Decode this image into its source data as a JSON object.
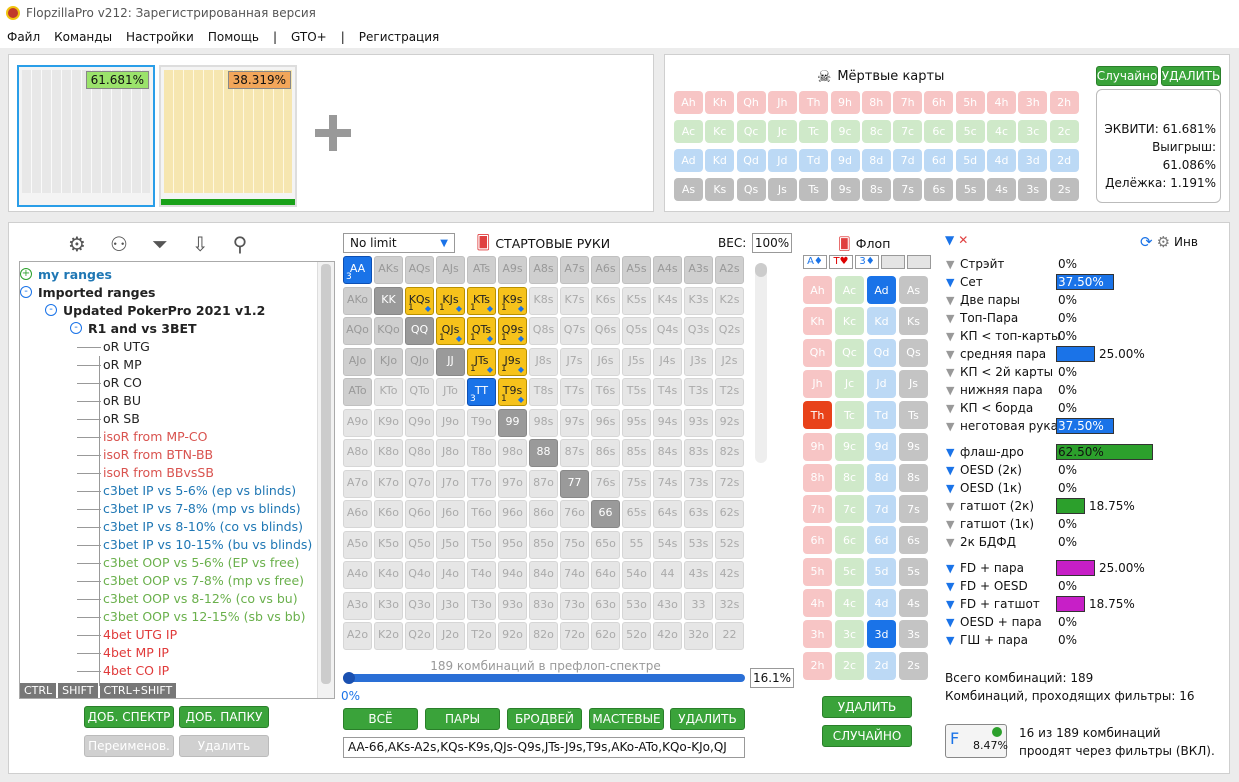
{
  "title": "FlopzillaPro v212: Зарегистрированная версия",
  "menu": [
    "Файл",
    "Команды",
    "Настройки",
    "Помощь",
    "|",
    "GTO+",
    "|",
    "Регистрация"
  ],
  "thumbs": [
    {
      "equity": "61.681%"
    },
    {
      "equity": "38.319%"
    }
  ],
  "dead_cards": {
    "label": "Мёртвые карты",
    "random_label": "Случайно",
    "delete_label": "УДАЛИТЬ",
    "rows": [
      [
        "Ah",
        "Kh",
        "Qh",
        "Jh",
        "Th",
        "9h",
        "8h",
        "7h",
        "6h",
        "5h",
        "4h",
        "3h",
        "2h"
      ],
      [
        "Ac",
        "Kc",
        "Qc",
        "Jc",
        "Tc",
        "9c",
        "8c",
        "7c",
        "6c",
        "5c",
        "4c",
        "3c",
        "2c"
      ],
      [
        "Ad",
        "Kd",
        "Qd",
        "Jd",
        "Td",
        "9d",
        "8d",
        "7d",
        "6d",
        "5d",
        "4d",
        "3d",
        "2d"
      ],
      [
        "As",
        "Ks",
        "Qs",
        "Js",
        "Ts",
        "9s",
        "8s",
        "7s",
        "6s",
        "5s",
        "4s",
        "3s",
        "2s"
      ]
    ],
    "equity": "ЭКВИТИ: 61.681%",
    "win": "Выигрыш: 61.086%",
    "tie": "Делёжка: 1.191%"
  },
  "tree": {
    "items": [
      {
        "label": "my ranges",
        "color": "#1f77b4",
        "bold": true,
        "indent": 0,
        "sign": "+"
      },
      {
        "label": "Imported ranges",
        "color": "#222",
        "bold": true,
        "indent": 0,
        "sign": "-"
      },
      {
        "label": "Updated PokerPro 2021 v1.2",
        "color": "#222",
        "bold": true,
        "indent": 1,
        "sign": "-"
      },
      {
        "label": "R1 and vs 3BET",
        "color": "#222",
        "bold": true,
        "indent": 2,
        "sign": "-"
      },
      {
        "label": "oR UTG",
        "color": "#222",
        "indent": 3
      },
      {
        "label": "oR MP",
        "color": "#222",
        "indent": 3
      },
      {
        "label": "oR CO",
        "color": "#222",
        "indent": 3
      },
      {
        "label": "oR BU",
        "color": "#222",
        "indent": 3
      },
      {
        "label": "oR SB",
        "color": "#222",
        "indent": 3
      },
      {
        "label": "isoR from MP-CO",
        "color": "#d9534f",
        "indent": 3
      },
      {
        "label": "isoR from BTN-BB",
        "color": "#d9534f",
        "indent": 3
      },
      {
        "label": "isoR from BBvsSB",
        "color": "#d9534f",
        "indent": 3
      },
      {
        "label": "c3bet IP vs 5-6% (ep vs blinds)",
        "color": "#1f77b4",
        "indent": 3
      },
      {
        "label": "c3bet IP vs 7-8% (mp vs blinds)",
        "color": "#1f77b4",
        "indent": 3
      },
      {
        "label": "c3bet IP vs 8-10% (co vs blinds)",
        "color": "#1f77b4",
        "indent": 3
      },
      {
        "label": "c3bet IP vs 10-15% (bu vs blinds)",
        "color": "#1f77b4",
        "indent": 3
      },
      {
        "label": "c3bet OOP vs 5-6% (EP vs free)",
        "color": "#6ab04c",
        "indent": 3
      },
      {
        "label": "c3bet OOP vs 7-8% (mp vs free)",
        "color": "#6ab04c",
        "indent": 3
      },
      {
        "label": "c3bet OOP vs 8-12% (co vs bu)",
        "color": "#6ab04c",
        "indent": 3
      },
      {
        "label": "c3bet OOP vs 12-15% (sb vs bb)",
        "color": "#6ab04c",
        "indent": 3
      },
      {
        "label": "4bet UTG IP",
        "color": "#e03a3a",
        "indent": 3
      },
      {
        "label": "4bet MP IP",
        "color": "#e03a3a",
        "indent": 3
      },
      {
        "label": "4bet CO IP",
        "color": "#e03a3a",
        "indent": 3
      }
    ],
    "ctrl": "CTRL",
    "shift": "SHIFT",
    "ctrlshift": "CTRL+SHIFT",
    "add_range": "ДОБ. СПЕКТР",
    "add_folder": "ДОБ. ПАПКУ",
    "rename": "Переименов.",
    "delete": "Удалить"
  },
  "matrix": {
    "mode": "No limit",
    "header": "СТАРТОВЫЕ РУКИ",
    "weight_label": "ВЕС:",
    "weight": "100%",
    "combos_text": "189 комбинаций в префлоп-спектре",
    "slider_left": "0%",
    "slider_right": "16.1%",
    "btn_all": "ВСЁ",
    "btn_pairs": "ПАРЫ",
    "btn_broadway": "БРОДВЕЙ",
    "btn_suited": "МАСТЕВЫЕ",
    "btn_delete": "УДАЛИТЬ",
    "range_text": "AA-66,AKs-A2s,KQs-K9s,QJs-Q9s,JTs-J9s,T9s,AKo-ATo,KQo-KJo,QJ",
    "selected": {
      "AA": {
        "type": "blue",
        "count": "3"
      },
      "KQs": {
        "type": "gold",
        "count": "1"
      },
      "KJs": {
        "type": "gold",
        "count": "1"
      },
      "KTs": {
        "type": "gold",
        "count": "1"
      },
      "K9s": {
        "type": "gold",
        "count": "1"
      },
      "QJs": {
        "type": "gold",
        "count": "1"
      },
      "QTs": {
        "type": "gold",
        "count": "1"
      },
      "Q9s": {
        "type": "gold",
        "count": "1"
      },
      "JTs": {
        "type": "gold",
        "count": "1"
      },
      "J9s": {
        "type": "gold",
        "count": "1"
      },
      "TT": {
        "type": "blue",
        "count": "3"
      },
      "T9s": {
        "type": "gold",
        "count": "1"
      },
      "KK": {
        "type": "dark"
      },
      "QQ": {
        "type": "dark"
      },
      "JJ": {
        "type": "dark"
      },
      "99": {
        "type": "dark"
      },
      "88": {
        "type": "dark"
      },
      "77": {
        "type": "dark"
      },
      "66": {
        "type": "dark"
      },
      "AKs": {
        "type": "mid"
      },
      "AQs": {
        "type": "mid"
      },
      "AJs": {
        "type": "mid"
      },
      "ATs": {
        "type": "mid"
      },
      "A9s": {
        "type": "mid"
      },
      "A8s": {
        "type": "mid"
      },
      "A7s": {
        "type": "mid"
      },
      "A6s": {
        "type": "mid"
      },
      "A5s": {
        "type": "mid"
      },
      "A4s": {
        "type": "mid"
      },
      "A3s": {
        "type": "mid"
      },
      "A2s": {
        "type": "mid"
      },
      "AKo": {
        "type": "mid"
      },
      "AQo": {
        "type": "mid"
      },
      "AJo": {
        "type": "mid"
      },
      "ATo": {
        "type": "mid"
      },
      "KQo": {
        "type": "mid"
      },
      "KJo": {
        "type": "mid"
      },
      "QJo": {
        "type": "mid"
      }
    }
  },
  "flop": {
    "label": "Флоп",
    "slots": [
      "A♦",
      "T♥",
      "3♦",
      "",
      ""
    ],
    "rows": [
      [
        "Ah",
        "Ac",
        "Ad",
        "As"
      ],
      [
        "Kh",
        "Kc",
        "Kd",
        "Ks"
      ],
      [
        "Qh",
        "Qc",
        "Qd",
        "Qs"
      ],
      [
        "Jh",
        "Jc",
        "Jd",
        "Js"
      ],
      [
        "Th",
        "Tc",
        "Td",
        "Ts"
      ],
      [
        "9h",
        "9c",
        "9d",
        "9s"
      ],
      [
        "8h",
        "8c",
        "8d",
        "8s"
      ],
      [
        "7h",
        "7c",
        "7d",
        "7s"
      ],
      [
        "6h",
        "6c",
        "6d",
        "6s"
      ],
      [
        "5h",
        "5c",
        "5d",
        "5s"
      ],
      [
        "4h",
        "4c",
        "4d",
        "4s"
      ],
      [
        "3h",
        "3c",
        "3d",
        "3s"
      ],
      [
        "2h",
        "2c",
        "2d",
        "2s"
      ]
    ],
    "selected": [
      "Ad",
      "Th",
      "3d"
    ],
    "delete_label": "УДАЛИТЬ",
    "random_label": "СЛУЧАЙНО"
  },
  "stats": {
    "inv": "Инв",
    "groups": [
      [
        {
          "label": "Стрэйт",
          "value": "0%",
          "pct": 0,
          "color": "#1a73e8",
          "blue": false
        },
        {
          "label": "Сет",
          "value": "37.50%",
          "pct": 37.5,
          "color": "#1a73e8",
          "blue": true,
          "inbar": true
        },
        {
          "label": "Две пары",
          "value": "0%",
          "pct": 0,
          "color": "#1a73e8",
          "blue": false
        },
        {
          "label": "Топ-Пара",
          "value": "0%",
          "pct": 0,
          "color": "#1a73e8",
          "blue": false
        },
        {
          "label": "КП < топ-карты",
          "value": "0%",
          "pct": 0,
          "color": "#1a73e8",
          "blue": false
        },
        {
          "label": "средняя пара",
          "value": "25.00%",
          "pct": 25,
          "color": "#1a73e8",
          "blue": false
        },
        {
          "label": "КП < 2й карты",
          "value": "0%",
          "pct": 0,
          "color": "#1a73e8",
          "blue": false
        },
        {
          "label": "нижняя пара",
          "value": "0%",
          "pct": 0,
          "color": "#1a73e8",
          "blue": false
        },
        {
          "label": "КП < борда",
          "value": "0%",
          "pct": 0,
          "color": "#1a73e8",
          "blue": false
        },
        {
          "label": "неготовая рука",
          "value": "37.50%",
          "pct": 37.5,
          "color": "#1a73e8",
          "blue": false,
          "inbar": true
        }
      ],
      [
        {
          "label": "флаш-дро",
          "value": "62.50%",
          "pct": 62.5,
          "color": "#2ca02c",
          "blue": true,
          "inbar": true
        },
        {
          "label": "OESD (2к)",
          "value": "0%",
          "pct": 0,
          "color": "#2ca02c",
          "blue": true
        },
        {
          "label": "OESD (1к)",
          "value": "0%",
          "pct": 0,
          "color": "#2ca02c",
          "blue": true
        },
        {
          "label": "гатшот (2к)",
          "value": "18.75%",
          "pct": 18.75,
          "color": "#2ca02c",
          "blue": false
        },
        {
          "label": "гатшот (1к)",
          "value": "0%",
          "pct": 0,
          "color": "#2ca02c",
          "blue": false
        },
        {
          "label": "2к БДФД",
          "value": "0%",
          "pct": 0,
          "color": "#2ca02c",
          "blue": false
        }
      ],
      [
        {
          "label": "FD + пара",
          "value": "25.00%",
          "pct": 25,
          "color": "#c71fc7",
          "blue": true
        },
        {
          "label": "FD + OESD",
          "value": "0%",
          "pct": 0,
          "color": "#c71fc7",
          "blue": true
        },
        {
          "label": "FD + гатшот",
          "value": "18.75%",
          "pct": 18.75,
          "color": "#c71fc7",
          "blue": true
        },
        {
          "label": "OESD + пара",
          "value": "0%",
          "pct": 0,
          "color": "#c71fc7",
          "blue": true
        },
        {
          "label": "ГШ + пара",
          "value": "0%",
          "pct": 0,
          "color": "#c71fc7",
          "blue": true
        }
      ]
    ],
    "total": "Всего комбинаций: 189",
    "passing": "Комбинаций, проходящих фильтры: 16",
    "filter_pct": "8.47%",
    "filter_text1": "16 из 189 комбинаций",
    "filter_text2": "проодят через фильтры (ВКЛ)."
  }
}
